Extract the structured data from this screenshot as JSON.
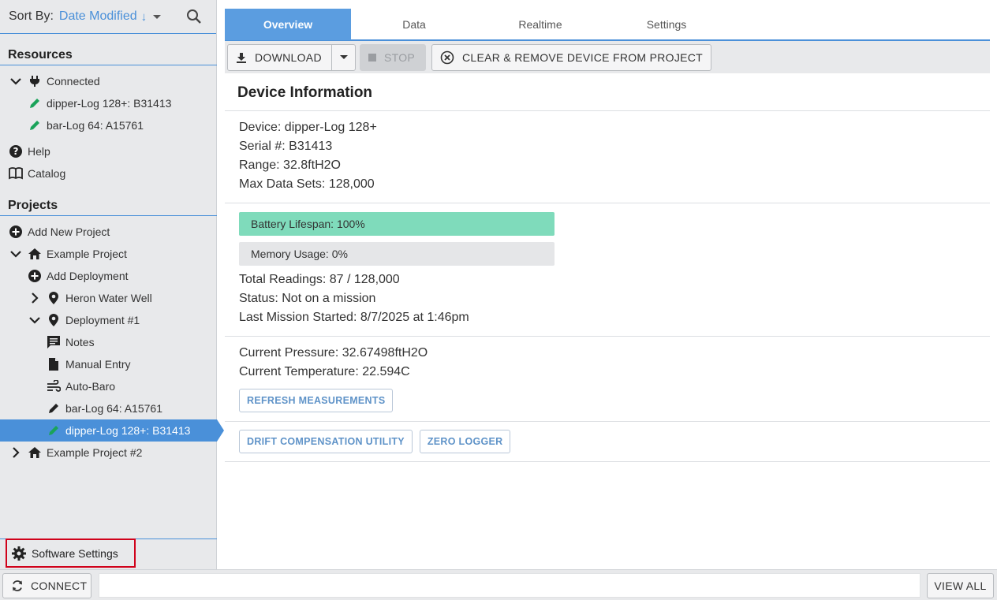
{
  "sidebar": {
    "sort_label": "Sort By:",
    "sort_value": "Date Modified",
    "sort_arrow": "↓",
    "resources_title": "Resources",
    "projects_title": "Projects",
    "connected": "Connected",
    "resource_devices": [
      "dipper-Log 128+: B31413",
      "bar-Log 64: A15761"
    ],
    "help": "Help",
    "catalog": "Catalog",
    "add_new_project": "Add New Project",
    "example_project": "Example Project",
    "add_deployment": "Add Deployment",
    "heron_water_well": "Heron Water Well",
    "deployment_1": "Deployment #1",
    "notes": "Notes",
    "manual_entry": "Manual Entry",
    "auto_baro": "Auto-Baro",
    "deployment_devices": [
      "bar-Log 64: A15761",
      "dipper-Log 128+: B31413"
    ],
    "example_project_2": "Example Project #2",
    "software_settings": "Software Settings"
  },
  "tabs": [
    "Overview",
    "Data",
    "Realtime",
    "Settings"
  ],
  "active_tab": "Overview",
  "toolbar": {
    "download": "DOWNLOAD",
    "stop": "STOP",
    "clear_remove": "CLEAR & REMOVE DEVICE FROM PROJECT"
  },
  "device": {
    "title": "Device Information",
    "device": "Device: dipper-Log 128+",
    "serial": "Serial #: B31413",
    "range": "Range: 32.8ftH2O",
    "max_data_sets": "Max Data Sets: 128,000",
    "battery_label": "Battery Lifespan: 100%",
    "battery_pct": 100,
    "memory_label": "Memory Usage: 0%",
    "memory_pct": 0,
    "total_readings": "Total Readings: 87 / 128,000",
    "status": "Status: Not on a mission",
    "last_mission": "Last Mission Started: 8/7/2025 at 1:46pm",
    "current_pressure": "Current Pressure: 32.67498ftH2O",
    "current_temperature": "Current Temperature: 22.594C",
    "refresh_button": "REFRESH MEASUREMENTS",
    "drift_button": "DRIFT COMPENSATION UTILITY",
    "zero_button": "ZERO LOGGER"
  },
  "bottom": {
    "connect": "CONNECT",
    "view_all": "VIEW ALL"
  },
  "colors": {
    "accent": "#4a90d9",
    "battery_fill": "#7fdbbb",
    "highlight_border": "#d0021b",
    "pencil_green": "#1aa35a"
  }
}
